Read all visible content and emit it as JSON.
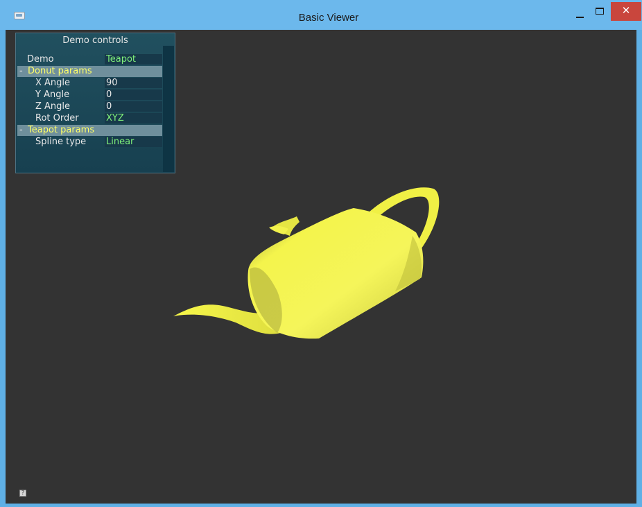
{
  "window": {
    "title": "Basic Viewer",
    "icons": {
      "app": "app-icon",
      "minimize": "minimize-icon",
      "maximize": "maximize-icon",
      "close": "close-icon"
    },
    "close_glyph": "✕"
  },
  "panel": {
    "title": "Demo controls",
    "rows": [
      {
        "label": "Demo",
        "value": "Teapot"
      },
      {
        "group": "Donut params",
        "toggle": "-"
      },
      {
        "label": "X Angle",
        "value": "90"
      },
      {
        "label": "Y Angle",
        "value": "0"
      },
      {
        "label": "Z Angle",
        "value": "0"
      },
      {
        "label": "Rot Order",
        "value": "XYZ"
      },
      {
        "group": "Teapot params",
        "toggle": "-"
      },
      {
        "label": "Spline type",
        "value": "Linear"
      }
    ]
  },
  "viewport": {
    "background_color": "#333333",
    "object_color": "#f2f24a",
    "help_icon": "help-icon"
  }
}
